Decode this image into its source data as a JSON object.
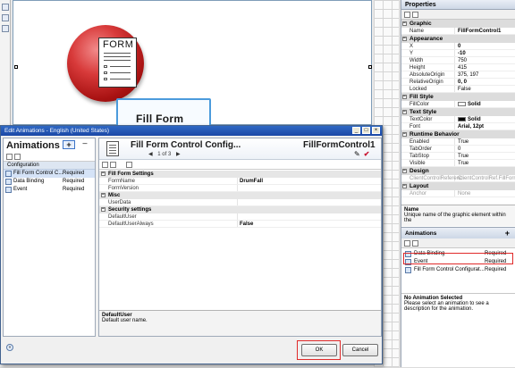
{
  "canvas": {
    "form_label": "FORM",
    "fill_form_label": "Fill Form"
  },
  "properties": {
    "title": "Properties",
    "groups": [
      {
        "name": "Graphic",
        "rows": [
          {
            "key": "Name",
            "value": "FillFormControl1",
            "bold": true
          }
        ]
      },
      {
        "name": "Appearance",
        "rows": [
          {
            "key": "X",
            "value": "0",
            "bold": true
          },
          {
            "key": "Y",
            "value": "-10",
            "bold": true
          },
          {
            "key": "Width",
            "value": "750",
            "bold": false
          },
          {
            "key": "Height",
            "value": "415",
            "bold": false
          },
          {
            "key": "AbsoluteOrigin",
            "value": "375, 197",
            "bold": false
          },
          {
            "key": "RelativeOrigin",
            "value": "0, 0",
            "bold": true
          },
          {
            "key": "Locked",
            "value": "False",
            "bold": false
          }
        ]
      },
      {
        "name": "Fill Style",
        "rows": [
          {
            "key": "FillColor",
            "value": "Solid",
            "bold": true,
            "swatch": "#ffffff"
          }
        ]
      },
      {
        "name": "Text Style",
        "rows": [
          {
            "key": "TextColor",
            "value": "Solid",
            "bold": true,
            "swatch": "#000000"
          },
          {
            "key": "Font",
            "value": "Arial, 12pt",
            "bold": true
          }
        ]
      },
      {
        "name": "Runtime Behavior",
        "rows": [
          {
            "key": "Enabled",
            "value": "True",
            "bold": false
          },
          {
            "key": "TabOrder",
            "value": "0",
            "bold": false
          },
          {
            "key": "TabStop",
            "value": "True",
            "bold": false
          },
          {
            "key": "Visible",
            "value": "True",
            "bold": false
          }
        ]
      },
      {
        "name": "Design",
        "rows": [
          {
            "key": "ClientControlReferenc",
            "value": "ClientControlRef.FillForm",
            "bold": false,
            "gray": true
          }
        ]
      },
      {
        "name": "Layout",
        "rows": [
          {
            "key": "Anchor",
            "value": "None",
            "bold": false,
            "gray": true
          }
        ]
      }
    ],
    "desc_title": "Name",
    "desc_text": "Unique name of the graphic element within the",
    "animations_title": "Animations",
    "animations_add": "+",
    "animations": [
      {
        "name": "Data Binding",
        "status": "Required"
      },
      {
        "name": "Event",
        "status": "Required"
      },
      {
        "name": "Fill Form Control Configurat...",
        "status": "Required"
      }
    ],
    "no_anim_title": "No Animation Selected",
    "no_anim_text": "Please select an animation to see a description for the animation."
  },
  "dialog": {
    "title": "Edit Animations - English (United States)",
    "animations_label": "Animations",
    "add_symbol": "+",
    "remove_symbol": "−",
    "configuration_label": "Configuration",
    "items": [
      {
        "name": "Fill Form Control C...",
        "status": "Required",
        "selected": true
      },
      {
        "name": "Data Binding",
        "status": "Required",
        "selected": false
      },
      {
        "name": "Event",
        "status": "Required",
        "selected": false
      }
    ],
    "main": {
      "title": "Fill Form Control Config...",
      "object": "FillFormControl1",
      "pager": "1 of 3",
      "groups": [
        {
          "name": "Fill Form Settings",
          "rows": [
            {
              "key": "FormName",
              "value": "DrumFall"
            },
            {
              "key": "FormVersion",
              "value": ""
            }
          ]
        },
        {
          "name": "Misc",
          "rows": [
            {
              "key": "UserData",
              "value": ""
            }
          ]
        },
        {
          "name": "Security settings",
          "rows": [
            {
              "key": "DefaultUser",
              "value": ""
            },
            {
              "key": "DefaultUserAlways",
              "value": "False"
            }
          ]
        }
      ],
      "desc_title": "DefaultUser",
      "desc_text": "Default user name."
    },
    "ok_label": "OK",
    "cancel_label": "Cancel"
  },
  "colors": {
    "titlebar": "#1b48a6",
    "highlight": "#e02a2a",
    "selection": "#4b9bdc"
  }
}
